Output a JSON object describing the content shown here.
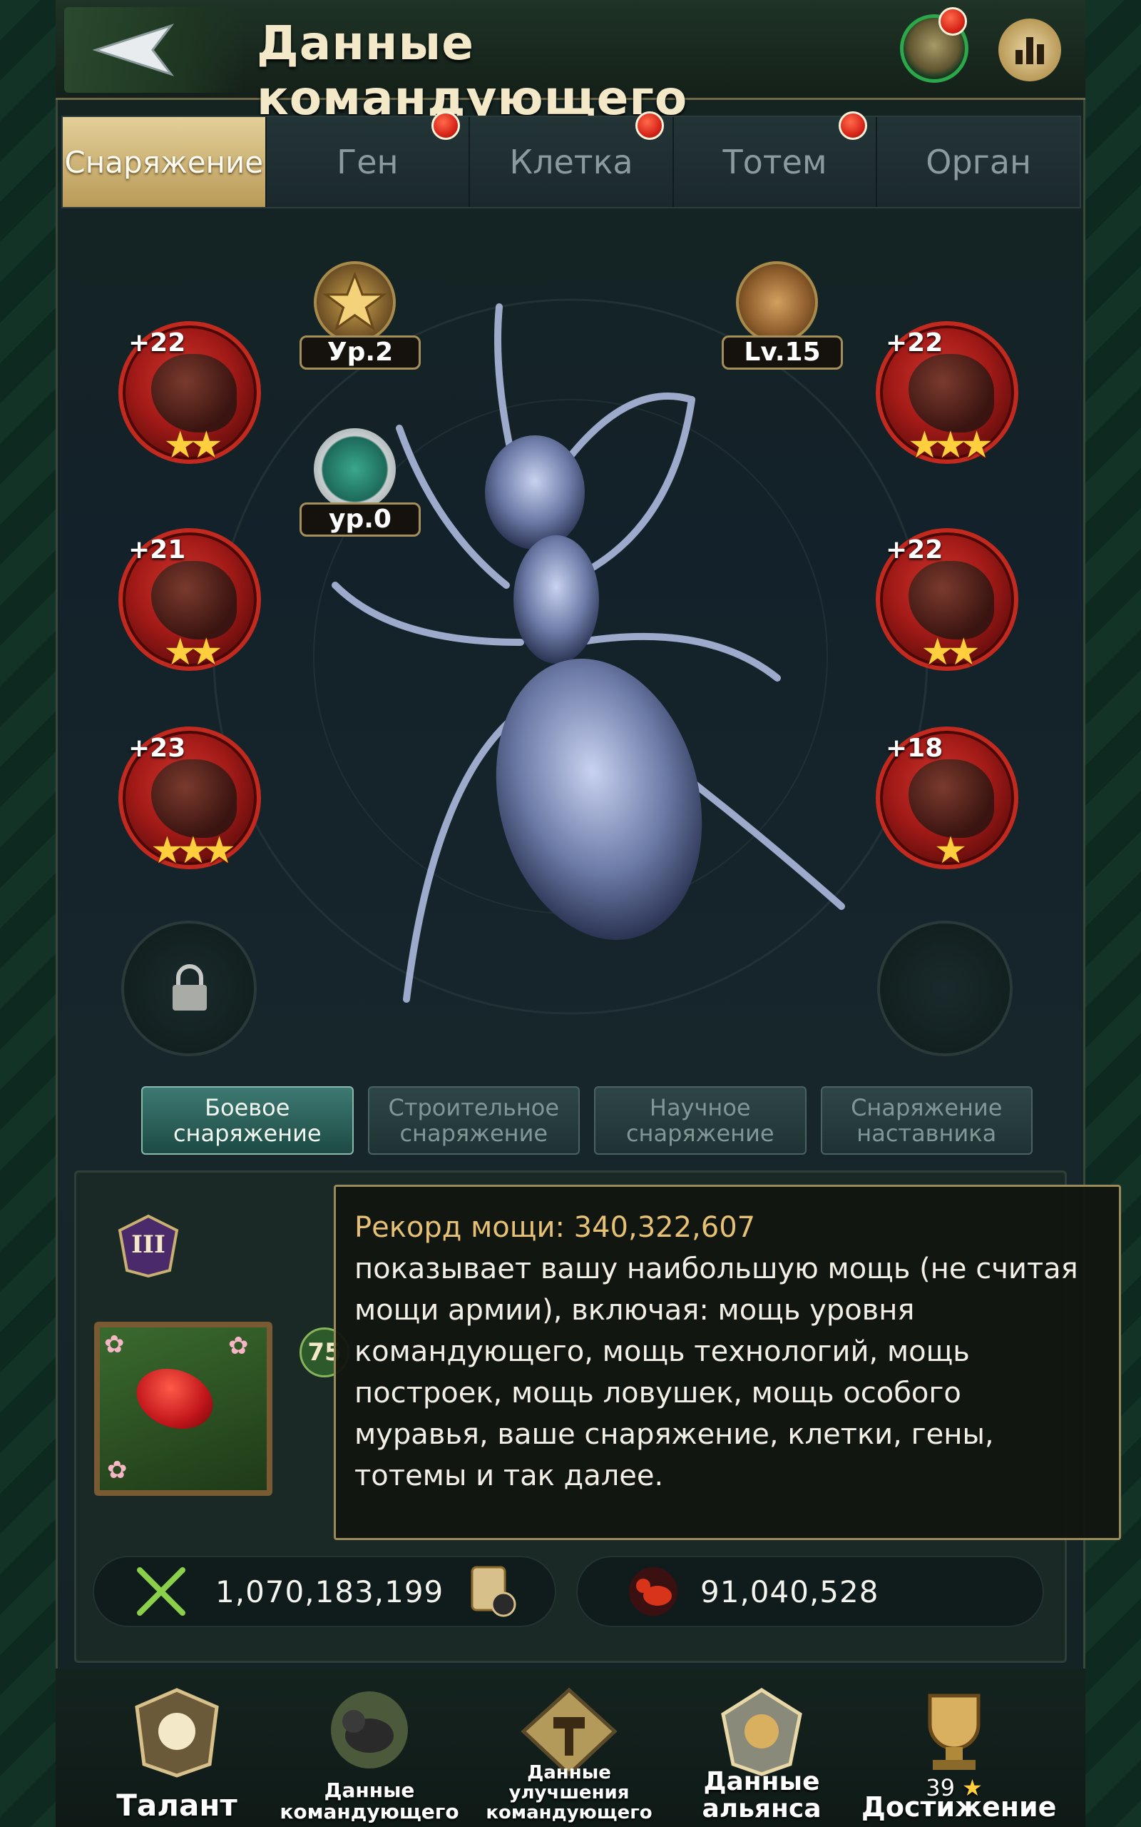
{
  "header": {
    "title": "Данные командующего"
  },
  "tabs": [
    {
      "label": "Снаряжение",
      "active": true,
      "dot": false
    },
    {
      "label": "Ген",
      "active": false,
      "dot": true
    },
    {
      "label": "Клетка",
      "active": false,
      "dot": true
    },
    {
      "label": "Тотем",
      "active": false,
      "dot": true
    },
    {
      "label": "Орган",
      "active": false,
      "dot": false
    }
  ],
  "equipment": {
    "left": [
      {
        "level": "+22",
        "stars": "★★"
      },
      {
        "level": "+21",
        "stars": "★★"
      },
      {
        "level": "+23",
        "stars": "★★★"
      }
    ],
    "right": [
      {
        "level": "+22",
        "stars": "★★★"
      },
      {
        "level": "+22",
        "stars": "★★"
      },
      {
        "level": "+18",
        "stars": "★"
      }
    ]
  },
  "badges": {
    "star_badge": "Ур.2",
    "emblem_badge": "ур.0",
    "ant_badge": "Lv.15"
  },
  "categories": [
    {
      "line1": "Боевое",
      "line2": "снаряжение",
      "active": true
    },
    {
      "line1": "Строительное",
      "line2": "снаряжение",
      "active": false
    },
    {
      "line1": "Научное",
      "line2": "снаряжение",
      "active": false
    },
    {
      "line1": "Снаряжение",
      "line2": "наставника",
      "active": false
    }
  ],
  "info": {
    "roman": "III",
    "level_chip": "75"
  },
  "tooltip": {
    "heading": "Рекорд мощи: 340,322,607",
    "body": "показывает вашу наибольшую мощь (не считая мощи армии), включая: мощь уровня командующего, мощь технологий, мощь построек, мощь ловушек, мощь особого муравья, ваше снаряжение, клетки, гены, тотемы и так далее."
  },
  "stats": {
    "power": "1,070,183,199",
    "army": "91,040,528"
  },
  "bottom_nav": [
    {
      "label": "Талант"
    },
    {
      "label": "Данные командующего"
    },
    {
      "label": "Данные улучшения командующего"
    },
    {
      "label": "Данные альянса"
    },
    {
      "label": "Достижение",
      "count": "39"
    }
  ],
  "colors": {
    "accent_gold": "#e3cf98",
    "equip_red": "#c2291f",
    "tooltip_heading": "#e6c074",
    "active_category": "#3d7a72"
  }
}
